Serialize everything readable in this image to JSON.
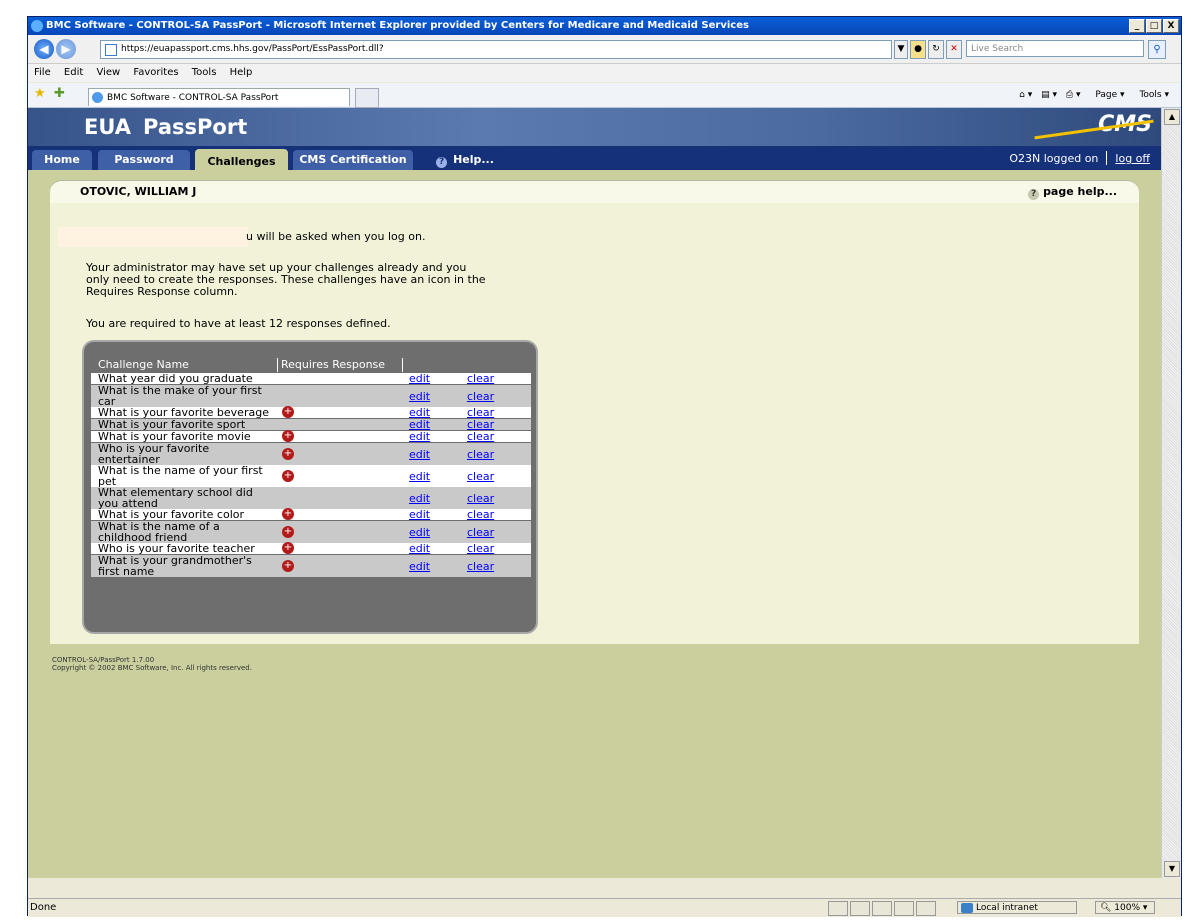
{
  "window": {
    "title": "BMC Software - CONTROL-SA PassPort - Microsoft Internet Explorer provided by Centers for Medicare and Medicaid Services",
    "controls": [
      "_",
      "□",
      "X"
    ]
  },
  "browser": {
    "address": "https://euapassport.cms.hhs.gov/PassPort/EssPassPort.dll?",
    "search_placeholder": "Live Search",
    "menu": [
      "File",
      "Edit",
      "View",
      "Favorites",
      "Tools",
      "Help"
    ],
    "tab_title": "BMC Software - CONTROL-SA PassPort",
    "commands": {
      "page": "Page",
      "tools": "Tools"
    }
  },
  "banner": {
    "app_name_1": "EUA",
    "app_name_2": "PassPort",
    "logo": "CMS"
  },
  "nav": {
    "tabs": [
      "Home",
      "Password",
      "Challenges",
      "CMS Certification"
    ],
    "help": "Help...",
    "logged_on": "O23N logged on",
    "log_off": "log off"
  },
  "panel": {
    "user_name": "OTOVIC, WILLIAM J",
    "page_help": "page help...",
    "intro_tail": "u will be asked when you log on.",
    "para_line1": "Your administrator may have set up your challenges already and you",
    "para_line2": "only need to create the responses. These challenges have an icon in the",
    "para_line3": "Requires Response column.",
    "required": "You are required to have at least 12 responses defined."
  },
  "table": {
    "headers": [
      "Challenge Name",
      "Requires Response"
    ],
    "edit_label": "edit",
    "clear_label": "clear",
    "rows": [
      {
        "l1": "What year did you graduate",
        "l2": "",
        "requires": false
      },
      {
        "l1": "What is the make of your first",
        "l2": "car",
        "requires": false
      },
      {
        "l1": "What is your favorite beverage",
        "l2": "",
        "requires": true
      },
      {
        "l1": "What is your favorite sport",
        "l2": "",
        "requires": false
      },
      {
        "l1": "What is your favorite movie",
        "l2": "",
        "requires": true
      },
      {
        "l1": "Who is your favorite",
        "l2": "entertainer",
        "requires": true
      },
      {
        "l1": "What is the name of your first",
        "l2": "pet",
        "requires": true
      },
      {
        "l1": "What elementary school did",
        "l2": "you attend",
        "requires": false
      },
      {
        "l1": "What is your favorite color",
        "l2": "",
        "requires": true
      },
      {
        "l1": "What is the name of a",
        "l2": "childhood friend",
        "requires": true
      },
      {
        "l1": "Who is your favorite teacher",
        "l2": "",
        "requires": true
      },
      {
        "l1": "What is your grandmother's",
        "l2": "first name",
        "requires": true
      }
    ]
  },
  "footer": {
    "line1": "CONTROL-SA/PassPort 1.7.00",
    "line2": "Copyright © 2002 BMC Software, Inc. All rights reserved."
  },
  "status": {
    "left": "Done",
    "zone": "Local intranet",
    "zoom": "100%"
  },
  "colors": {
    "content_bg": "#cbcf9e",
    "panel_bg": "#f2f2d9",
    "nav_bg": "#15317a",
    "link": "#0000ff",
    "required_icon": "#b31b1b"
  }
}
